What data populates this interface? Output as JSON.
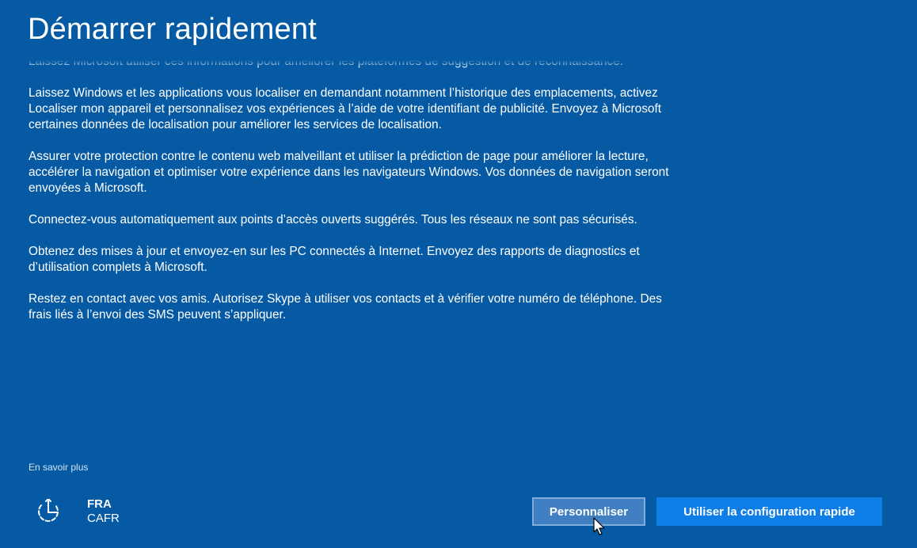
{
  "page": {
    "title": "Démarrer rapidement"
  },
  "content": {
    "paragraphs": [
      "Laissez Microsoft utiliser ces informations pour améliorer les plateformes de suggestion et de reconnaissance.",
      "Laissez Windows et les applications vous localiser en demandant notamment l’historique des emplacements, activez Localiser mon appareil et personnalisez vos expériences à l’aide de votre identifiant de publicité. Envoyez à Microsoft certaines données de localisation pour améliorer les services de localisation.",
      "Assurer votre protection contre le contenu web malveillant et utiliser la prédiction de page pour améliorer la lecture, accélérer la navigation et optimiser votre expérience dans les navigateurs Windows. Vos données de navigation seront envoyées à Microsoft.",
      "Connectez-vous automatiquement aux points d’accès ouverts suggérés. Tous les réseaux ne sont pas sécurisés.",
      "Obtenez des mises à jour et envoyez-en sur les PC connectés à Internet. Envoyez des rapports de diagnostics et d’utilisation complets à Microsoft.",
      "Restez en contact avec vos amis. Autorisez Skype à utiliser vos contacts et à vérifier votre numéro de téléphone. Des frais liés à l’envoi des SMS peuvent s’appliquer."
    ],
    "learn_more": "En savoir plus"
  },
  "footer": {
    "accessibility_icon": "ease-of-access-icon",
    "language": "FRA",
    "keyboard": "CAFR",
    "customize_label": "Personnaliser",
    "express_label": "Utiliser la configuration rapide"
  },
  "colors": {
    "background": "#065aa3",
    "express_button": "#0f7de6",
    "customize_button": "#3f7fc2"
  }
}
